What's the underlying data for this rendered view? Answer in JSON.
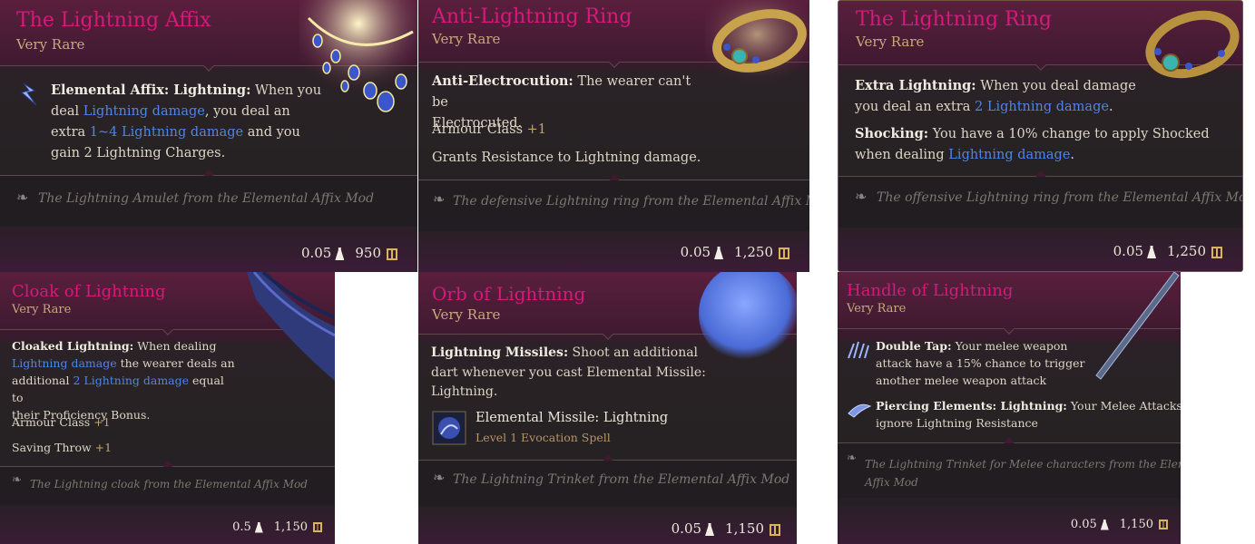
{
  "cards": [
    {
      "title": "The Lightning Affix",
      "rarity": "Very Rare",
      "lines": [
        {
          "label": "Elemental Affix: Lightning:",
          "t1": " When you",
          "t2": "deal ",
          "l1": "Lightning damage",
          "t3": ", you deal an",
          "t4": "extra ",
          "l2": "1~4 Lightning damage",
          "t5": " and you",
          "t6": "gain 2  Lightning Charges."
        }
      ],
      "flavor": "The Lightning Amulet from the Elemental Affix Mod",
      "weight": "0.05",
      "price": "950"
    },
    {
      "title": "Anti-Lightning Ring",
      "rarity": "Very Rare",
      "p1_label": "Anti-Electrocution:",
      "p1_text1": " The wearer can't be",
      "p1_text2": "Electrocuted.",
      "p2_label": "Armour Class ",
      "p2_value": "+1",
      "p3": "Grants Resistance to Lightning damage.",
      "flavor": "The defensive Lightning ring from the Elemental Affix Mod",
      "weight": "0.05",
      "price": "1,250"
    },
    {
      "title": "The Lightning Ring",
      "rarity": "Very Rare",
      "p1_label": "Extra Lightning:",
      "p1_text1": " When you deal damage",
      "p1_text2": "you deal an extra ",
      "p1_link": "2 Lightning damage",
      "p1_text3": ".",
      "p2_label": "Shocking:",
      "p2_text1": " You have a 10% change to apply Shocked",
      "p2_text2": "when dealing  ",
      "p2_link": "Lightning damage",
      "p2_text3": ".",
      "flavor": "The offensive Lightning ring from the Elemental Affix Mod",
      "weight": "0.05",
      "price": "1,250"
    },
    {
      "title": "Cloak of Lightning",
      "rarity": "Very Rare",
      "p1_label": "Cloaked Lightning:",
      "p1_text1": " When dealing",
      "p1_link1": "Lightning damage",
      "p1_text2": " the wearer deals an",
      "p1_text3": "additional ",
      "p1_link2": "2 Lightning damage",
      "p1_text4": " equal to",
      "p1_text5": "their Proficiency Bonus.",
      "p2_label": "Armour Class ",
      "p2_value": "+1",
      "p3_label": "Saving Throw ",
      "p3_value": "+1",
      "flavor": "The Lightning cloak from the Elemental Affix Mod",
      "weight": "0.5",
      "price": "1,150"
    },
    {
      "title": "Orb of Lightning",
      "rarity": "Very Rare",
      "p1_label": "Lightning Missiles:",
      "p1_text1": " Shoot an additional",
      "p1_text2": "dart whenever you cast Elemental Missile:",
      "p1_text3": "Lightning.",
      "spell_name": "Elemental Missile: Lightning",
      "spell_level": "Level 1 Evocation Spell",
      "flavor": "The Lightning Trinket from the Elemental Affix Mod",
      "weight": "0.05",
      "price": "1,150"
    },
    {
      "title": "Handle of Lightning",
      "rarity": "Very Rare",
      "p1_label": "Double Tap:",
      "p1_text1": " Your melee weapon",
      "p1_text2": "attack have a 15% chance to trigger",
      "p1_text3": "another melee weapon attack",
      "p2_label": "Piercing Elements: Lightning:",
      "p2_text1": " Your Melee Attacks",
      "p2_text2": "ignore Lightning Resistance",
      "flavor1": "The Lightning Trinket for Melee characters from the Elemental",
      "flavor2": "Affix Mod",
      "weight": "0.05",
      "price": "1,150"
    }
  ]
}
